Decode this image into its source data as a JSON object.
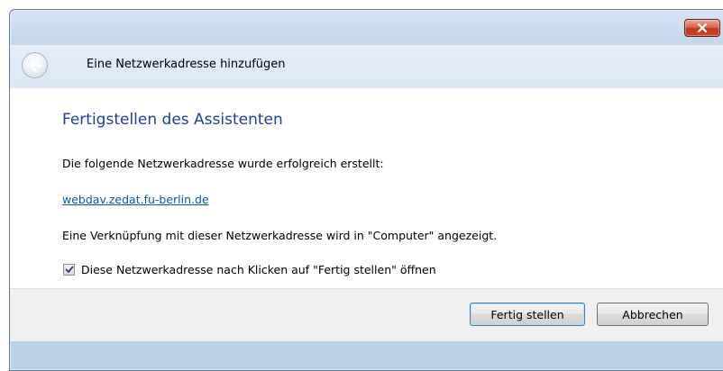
{
  "window": {
    "title": "Eine Netzwerkadresse hinzufügen",
    "close_icon": "close-icon",
    "back_icon": "back-arrow-icon"
  },
  "content": {
    "heading": "Fertigstellen des Assistenten",
    "success_text": "Die folgende Netzwerkadresse wurde erfolgreich erstellt:",
    "network_address": "webdav.zedat.fu-berlin.de",
    "shortcut_text": "Eine Verknüpfung mit dieser Netzwerkadresse wird in \"Computer\" angezeigt.",
    "open_checkbox": {
      "label": "Diese Netzwerkadresse nach Klicken auf \"Fertig stellen\" öffnen",
      "checked": true
    }
  },
  "footer": {
    "finish_button": "Fertig stellen",
    "cancel_button": "Abbrechen"
  },
  "colors": {
    "heading": "#1e3f9b",
    "link": "#0f54b3",
    "close_button": "#c74a2c"
  }
}
